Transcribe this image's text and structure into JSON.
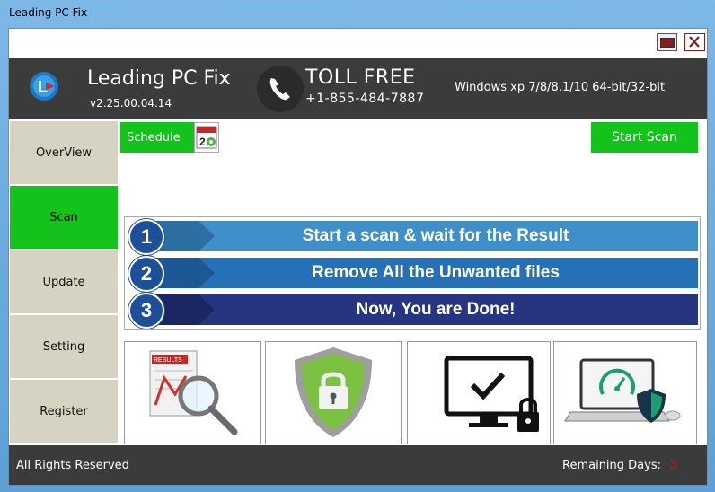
{
  "window": {
    "title": "Leading PC Fix"
  },
  "header": {
    "app_name": "Leading PC Fix",
    "version": "v2.25.00.04.14",
    "toll_label": "TOLL FREE",
    "phone": "+1-855-484-7887",
    "os_info": "Windows xp 7/8/8.1/10 64-bit/32-bit"
  },
  "sidebar": {
    "items": [
      {
        "label": "OverView",
        "active": false
      },
      {
        "label": "Scan",
        "active": true
      },
      {
        "label": "Update",
        "active": false
      },
      {
        "label": "Setting",
        "active": false
      },
      {
        "label": "Register",
        "active": false
      }
    ]
  },
  "toolbar": {
    "schedule_label": "Schedule",
    "start_scan_label": "Start Scan"
  },
  "steps": [
    {
      "number": "1",
      "text": "Start a scan & wait for the Result",
      "color": "#3f8fca"
    },
    {
      "number": "2",
      "text": "Remove All the Unwanted files",
      "color": "#2571b8"
    },
    {
      "number": "3",
      "text": "Now, You are Done!",
      "color": "#25357f"
    }
  ],
  "tiles": [
    {
      "icon": "results-magnifier-icon",
      "badge": "RESULTS"
    },
    {
      "icon": "shield-lock-icon"
    },
    {
      "icon": "monitor-check-lock-icon"
    },
    {
      "icon": "laptop-speed-shield-icon"
    }
  ],
  "footer": {
    "rights": "All Rights Reserved",
    "remaining_label": "Remaining Days:",
    "remaining_days": "3"
  },
  "colors": {
    "accent_green": "#13c21a",
    "header_bg": "#3b3b3b",
    "nav_bg": "#d6d3c2",
    "days_red": "#e01010"
  }
}
